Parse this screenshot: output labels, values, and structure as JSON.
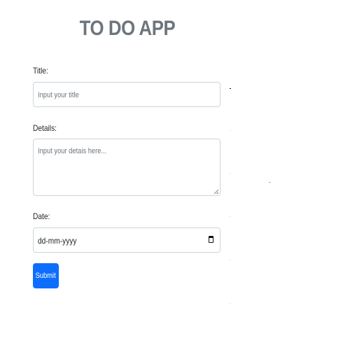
{
  "app": {
    "title": "TO DO APP"
  },
  "form": {
    "title_label": "Title:",
    "title_placeholder": "Input your title",
    "details_label": "Details:",
    "details_placeholder": "Input your detais here...",
    "date_label": "Date:",
    "date_value": "dd-mm-yyyy",
    "submit_label": "Submit"
  },
  "icons": {
    "date": "calendar-icon",
    "textarea_resize": "resize-handle-icon"
  },
  "colors": {
    "title": "#6c757d",
    "submit_background": "#0d6efd",
    "submit_text": "#ffffff",
    "input_border": "#ced4da",
    "placeholder": "#6c757d"
  }
}
